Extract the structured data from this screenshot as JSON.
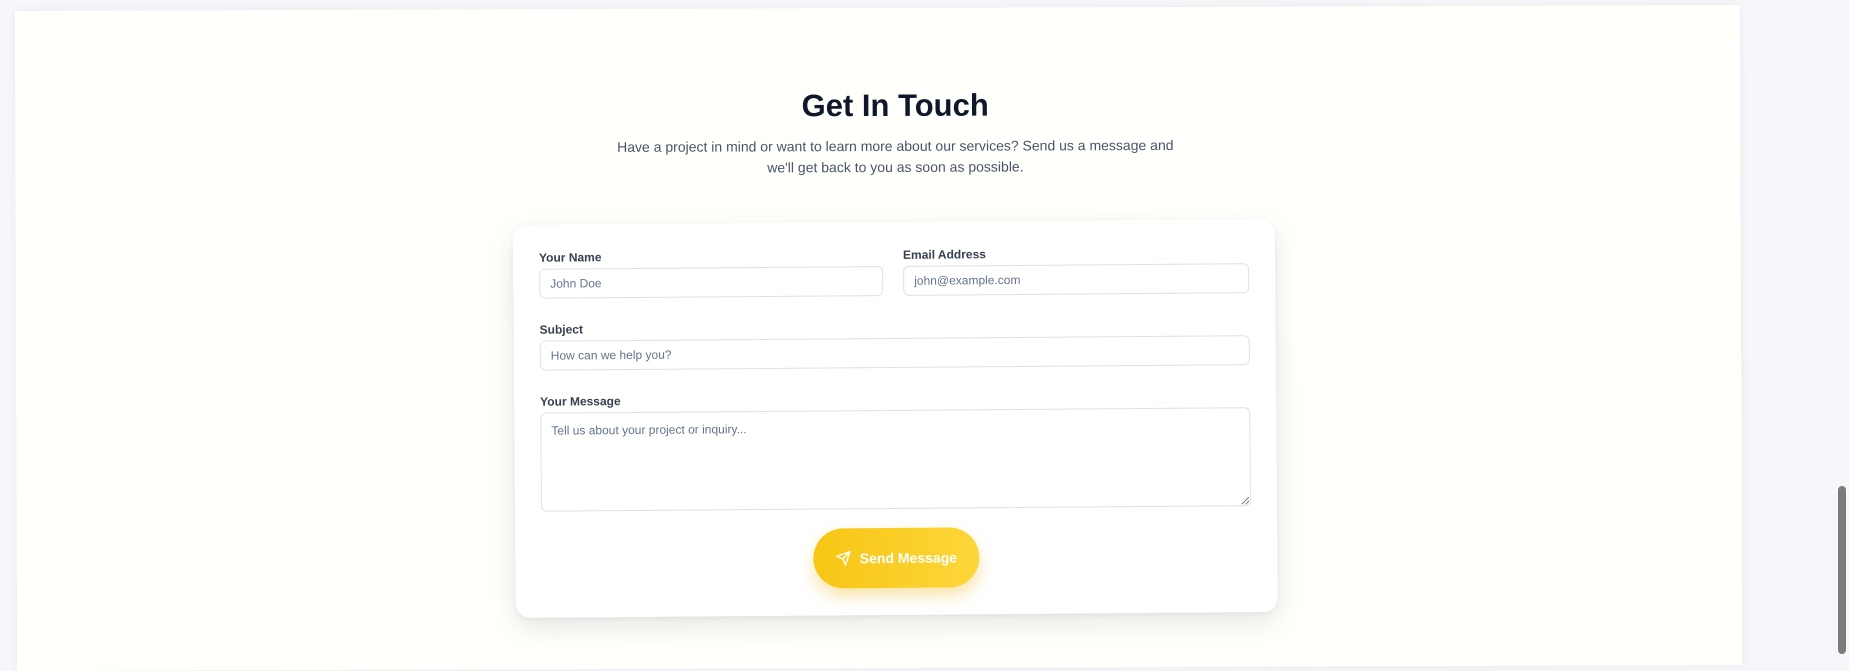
{
  "contact": {
    "title": "Get In Touch",
    "subtitle": "Have a project in mind or want to learn more about our services? Send us a message and we'll get back to you as soon as possible."
  },
  "form": {
    "name_label": "Your Name",
    "name_placeholder": "John Doe",
    "email_label": "Email Address",
    "email_placeholder": "john@example.com",
    "subject_label": "Subject",
    "subject_placeholder": "How can we help you?",
    "message_label": "Your Message",
    "message_placeholder": "Tell us about your project or inquiry...",
    "submit_label": "Send Message",
    "submit_icon": "send-icon"
  },
  "colors": {
    "accent": "#FACC15",
    "heading": "#0F172A",
    "background": "#FFFFFB"
  }
}
